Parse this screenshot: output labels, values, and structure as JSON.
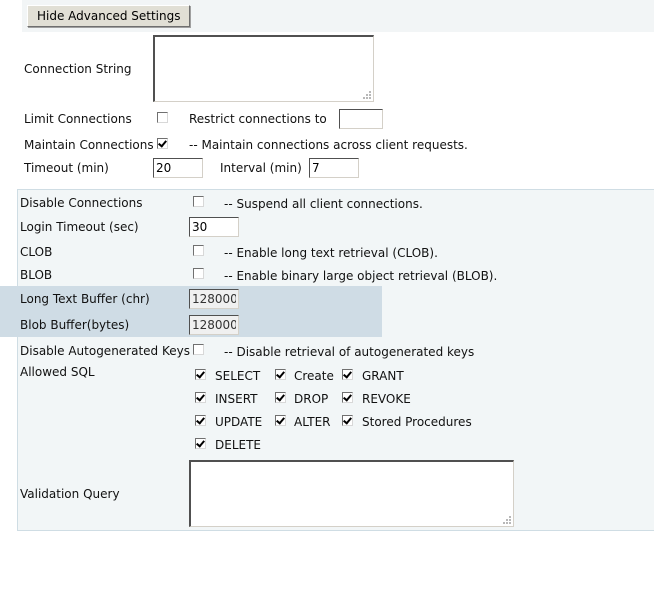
{
  "toolbar": {
    "hide_advanced_label": "Hide Advanced Settings"
  },
  "basic": {
    "connection_string": {
      "label": "Connection String",
      "value": ""
    },
    "limit_connections": {
      "label": "Limit Connections",
      "checked": false,
      "restrict_label": "Restrict connections to",
      "restrict_value": ""
    },
    "maintain_connections": {
      "label": "Maintain Connections",
      "checked": true,
      "description": "-- Maintain connections across client requests."
    },
    "timeout": {
      "label": "Timeout (min)",
      "value": "20"
    },
    "interval": {
      "label": "Interval (min)",
      "value": "7"
    }
  },
  "advanced": {
    "disable_connections": {
      "label": "Disable Connections",
      "checked": false,
      "description": "-- Suspend all client connections."
    },
    "login_timeout": {
      "label": "Login Timeout (sec)",
      "value": "30"
    },
    "clob": {
      "label": "CLOB",
      "checked": false,
      "description": "-- Enable long text retrieval (CLOB)."
    },
    "blob": {
      "label": "BLOB",
      "checked": false,
      "description": "-- Enable binary large object retrieval (BLOB)."
    },
    "long_text_buffer": {
      "label": "Long Text Buffer (chr)",
      "value": "128000"
    },
    "blob_buffer": {
      "label": "Blob Buffer(bytes)",
      "value": "128000"
    },
    "disable_autogen_keys": {
      "label": "Disable Autogenerated Keys",
      "checked": false,
      "description": "-- Disable retrieval of autogenerated keys"
    },
    "allowed_sql": {
      "label": "Allowed SQL",
      "options": [
        {
          "label": "SELECT",
          "checked": true
        },
        {
          "label": "Create",
          "checked": true
        },
        {
          "label": "GRANT",
          "checked": true
        },
        {
          "label": "INSERT",
          "checked": true
        },
        {
          "label": "DROP",
          "checked": true
        },
        {
          "label": "REVOKE",
          "checked": true
        },
        {
          "label": "UPDATE",
          "checked": true
        },
        {
          "label": "ALTER",
          "checked": true
        },
        {
          "label": "Stored Procedures",
          "checked": true
        },
        {
          "label": "DELETE",
          "checked": true
        }
      ]
    },
    "validation_query": {
      "label": "Validation Query",
      "value": ""
    }
  }
}
